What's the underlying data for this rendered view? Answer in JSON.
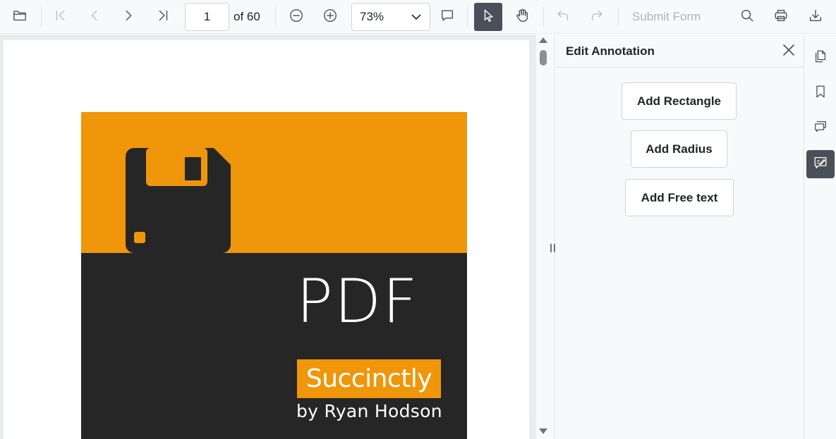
{
  "toolbar": {
    "icons": {
      "open": "folder-icon",
      "first_page": "first-page-icon",
      "previous_page": "chevron-left-icon",
      "next_page": "chevron-right-icon",
      "last_page": "last-page-icon",
      "zoom_out": "zoom-out-icon",
      "zoom_in": "zoom-in-icon",
      "comment": "comment-icon",
      "select": "pointer-icon",
      "pan": "hand-icon",
      "undo": "undo-icon",
      "redo": "redo-icon",
      "search": "search-icon",
      "print": "print-icon",
      "download": "download-icon"
    },
    "current_page": "1",
    "page_count_label": "of 60",
    "zoom_value": "73%",
    "submit_form_label": "Submit Form",
    "active_tool": "select"
  },
  "document": {
    "cover": {
      "title": "PDF",
      "series": "Succinctly",
      "author": "by Ryan Hodson",
      "icon": "floppy-disk-icon",
      "colors": {
        "accent": "#f0960b",
        "dark": "#262626"
      }
    }
  },
  "panel": {
    "title": "Edit Annotation",
    "close_icon": "close-icon",
    "buttons": {
      "add_rectangle": "Add Rectangle",
      "add_radius": "Add Radius",
      "add_free_text": "Add Free text"
    }
  },
  "sidebar_nav": {
    "items": [
      {
        "icon": "page-thumbnails-icon",
        "active": false
      },
      {
        "icon": "bookmark-icon",
        "active": false
      },
      {
        "icon": "comments-icon",
        "active": false
      },
      {
        "icon": "edit-annotation-icon",
        "active": true
      }
    ]
  },
  "colors": {
    "toolbar_bg": "#f8f9fa",
    "active_bg": "#495057",
    "disabled_text": "#adb5bd"
  }
}
